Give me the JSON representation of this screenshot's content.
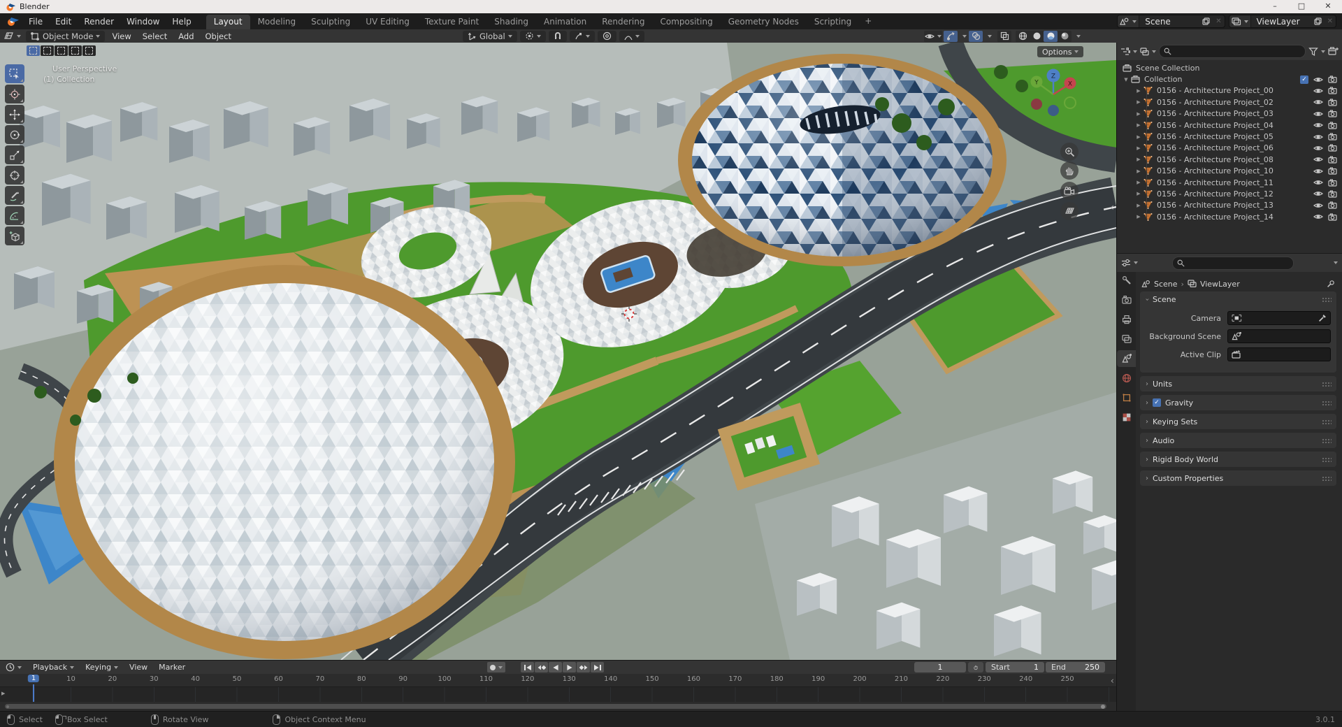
{
  "window": {
    "title": "Blender"
  },
  "topbar": {
    "menus": [
      "File",
      "Edit",
      "Render",
      "Window",
      "Help"
    ],
    "workspaces": [
      "Layout",
      "Modeling",
      "Sculpting",
      "UV Editing",
      "Texture Paint",
      "Shading",
      "Animation",
      "Rendering",
      "Compositing",
      "Geometry Nodes",
      "Scripting"
    ],
    "active_workspace": "Layout",
    "new_workspace_label": "+",
    "scene": {
      "label": "Scene"
    },
    "view_layer": {
      "label": "ViewLayer"
    }
  },
  "viewport_header": {
    "mode": "Object Mode",
    "menus": [
      "View",
      "Select",
      "Add",
      "Object"
    ],
    "orientation": "Global",
    "shading_modes": [
      "wireframe",
      "solid",
      "material",
      "rendered"
    ],
    "active_shading": "material",
    "options_label": "Options"
  },
  "viewport": {
    "view_label": "User Perspective",
    "collection_label": "(1) Collection",
    "axis_x": "X",
    "axis_y": "Y",
    "axis_z": "Z",
    "select_modes": [
      "set",
      "extend",
      "subtract",
      "invert",
      "intersect"
    ],
    "active_select_mode": "set",
    "toolbar_tools": [
      "select-box",
      "cursor",
      "move",
      "rotate",
      "scale",
      "transform",
      "annotate",
      "measure",
      "add-cube"
    ],
    "active_tool": "select-box",
    "nav_icons": [
      "zoom-icon",
      "pan-hand-icon",
      "camera-view-icon",
      "toggle-ortho-icon"
    ]
  },
  "outliner": {
    "scene_collection": "Scene Collection",
    "collection": {
      "label": "Collection",
      "checked": true
    },
    "items": [
      "0156 - Architecture Project_00",
      "0156 - Architecture Project_02",
      "0156 - Architecture Project_03",
      "0156 - Architecture Project_04",
      "0156 - Architecture Project_05",
      "0156 - Architecture Project_06",
      "0156 - Architecture Project_08",
      "0156 - Architecture Project_10",
      "0156 - Architecture Project_11",
      "0156 - Architecture Project_12",
      "0156 - Architecture Project_13",
      "0156 - Architecture Project_14"
    ]
  },
  "properties": {
    "tabs": [
      "tool",
      "render",
      "output",
      "view-layer",
      "scene",
      "world",
      "object",
      "texture"
    ],
    "active_tab": "scene",
    "breadcrumb": {
      "scene": "Scene",
      "view_layer": "ViewLayer"
    },
    "scene_panel": {
      "title": "Scene",
      "fields": [
        {
          "label": "Camera",
          "icon": "camera",
          "eyedropper": true
        },
        {
          "label": "Background Scene",
          "icon": "scene"
        },
        {
          "label": "Active Clip",
          "icon": "clip"
        }
      ]
    },
    "panels": [
      {
        "label": "Units"
      },
      {
        "label": "Gravity",
        "checkbox": true
      },
      {
        "label": "Keying Sets"
      },
      {
        "label": "Audio"
      },
      {
        "label": "Rigid Body World"
      },
      {
        "label": "Custom Properties"
      }
    ]
  },
  "timeline": {
    "menus": [
      {
        "label": "Playback",
        "caret": true
      },
      {
        "label": "Keying",
        "caret": true
      },
      {
        "label": "View"
      },
      {
        "label": "Marker"
      }
    ],
    "transport": [
      "jump-start",
      "prev-key",
      "play-back",
      "play",
      "next-key",
      "jump-end"
    ],
    "current_frame": "1",
    "start": {
      "label": "Start",
      "value": "1"
    },
    "end": {
      "label": "End",
      "value": "250"
    },
    "ticks": [
      1,
      10,
      20,
      30,
      40,
      50,
      60,
      70,
      80,
      90,
      100,
      110,
      120,
      130,
      140,
      150,
      160,
      170,
      180,
      190,
      200,
      210,
      220,
      230,
      240,
      250
    ]
  },
  "status_bar": {
    "hints": [
      {
        "icon": "lmb",
        "label": "Select"
      },
      {
        "icon": "lmb-drag",
        "label": "Box Select"
      },
      {
        "icon": "mmb",
        "label": "Rotate View"
      },
      {
        "icon": "rmb",
        "label": "Object Context Menu"
      }
    ],
    "version": "3.0.1"
  },
  "colors": {
    "accent": "#4772b3",
    "mesh_icon_orange": "#e2833f",
    "current_frame_blue": "#4772b3"
  }
}
